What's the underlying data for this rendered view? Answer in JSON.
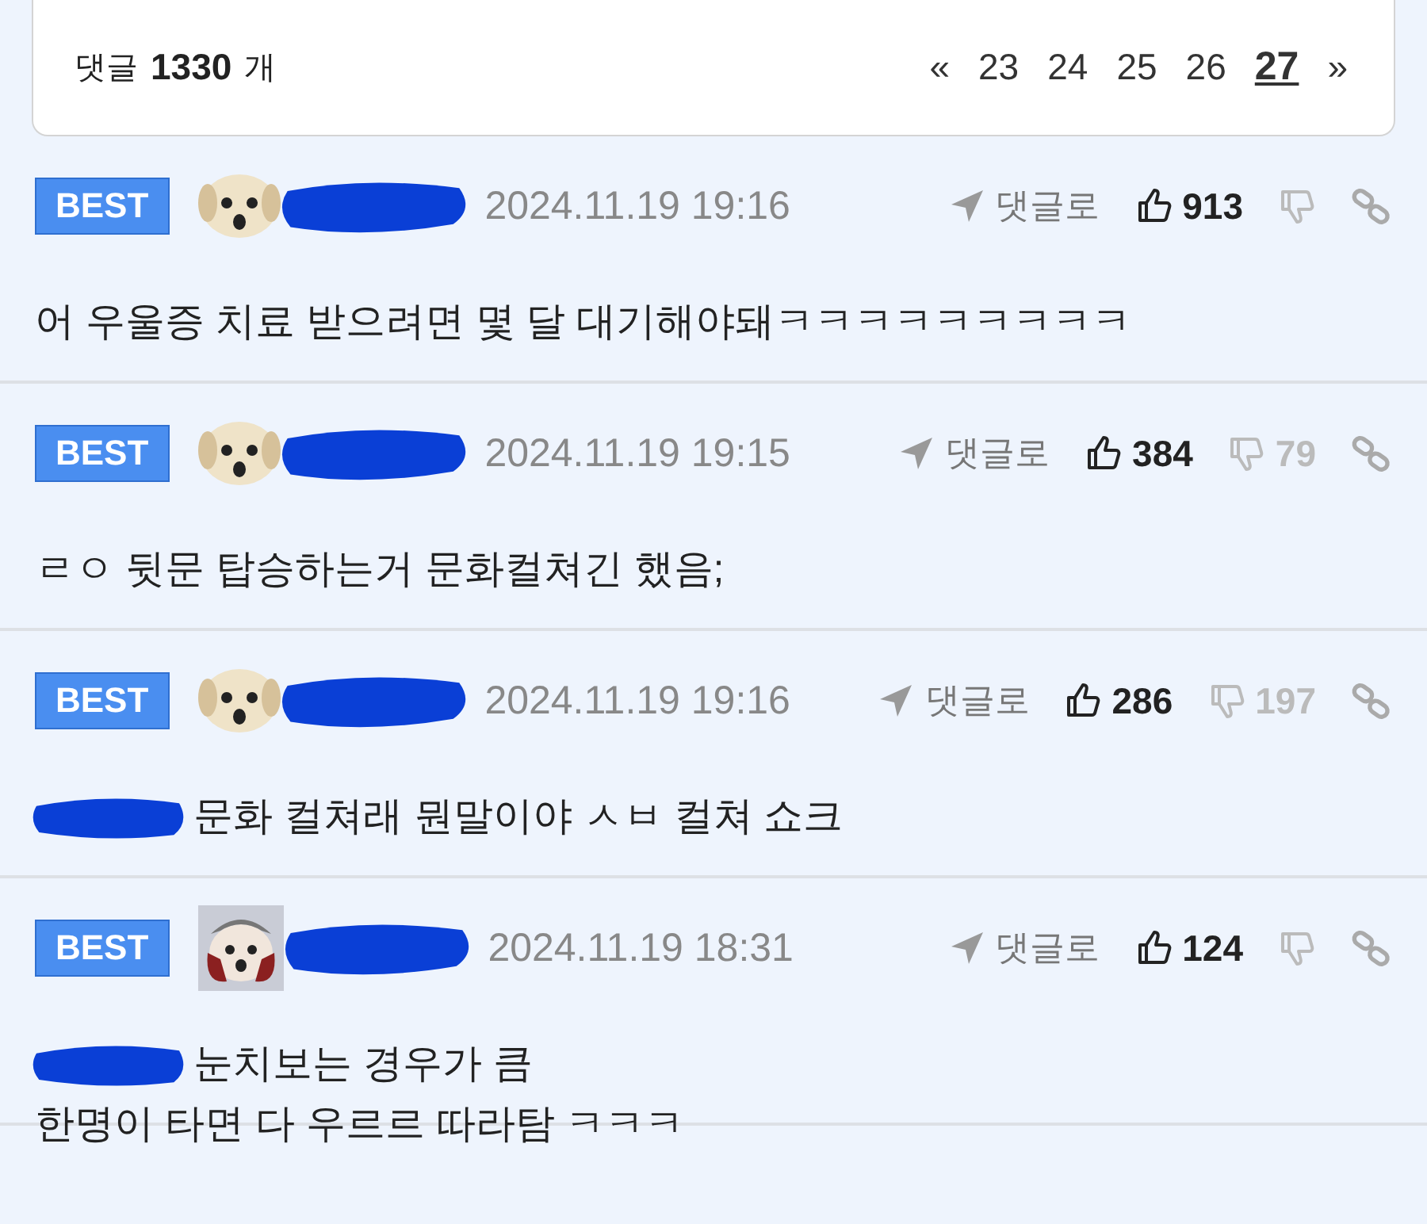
{
  "header": {
    "label": "댓글",
    "count": "1330",
    "unit": "개",
    "pagination": {
      "prev": "«",
      "next": "»",
      "pages": [
        {
          "label": "23",
          "selected": false
        },
        {
          "label": "24",
          "selected": false
        },
        {
          "label": "25",
          "selected": false
        },
        {
          "label": "26",
          "selected": false
        },
        {
          "label": "27",
          "selected": true
        }
      ]
    }
  },
  "comments": [
    {
      "badge": "BEST",
      "avatar": {
        "kind": "round"
      },
      "time": "2024.11.19 19:16",
      "reply": "댓글로",
      "likes": "913",
      "text": [
        "어 우울증 치료 받으려면 몇 달 대기해야돼ㅋㅋㅋㅋㅋㅋㅋㅋㅋ"
      ],
      "mention_redacted": false
    },
    {
      "badge": "BEST",
      "avatar": {
        "kind": "round"
      },
      "time": "2024.11.19 19:15",
      "reply": "댓글로",
      "likes": "384",
      "dislikes": "79",
      "text": [
        "ㄹㅇ 뒷문 탑승하는거 문화컬쳐긴 했음;"
      ],
      "mention_redacted": false
    },
    {
      "badge": "BEST",
      "avatar": {
        "kind": "round"
      },
      "time": "2024.11.19 19:16",
      "reply": "댓글로",
      "likes": "286",
      "dislikes": "197",
      "text": [
        "문화 컬쳐래 뭔말이야 ㅅㅂ 컬쳐 쇼크"
      ],
      "mention_redacted": true
    },
    {
      "badge": "BEST",
      "avatar": {
        "kind": "framed"
      },
      "time": "2024.11.19 18:31",
      "reply": "댓글로",
      "likes": "124",
      "text": [
        "눈치보는 경우가 큼",
        "한명이 타면 다 우르르 따라탐 ㅋㅋㅋ"
      ],
      "mention_redacted": true
    }
  ]
}
